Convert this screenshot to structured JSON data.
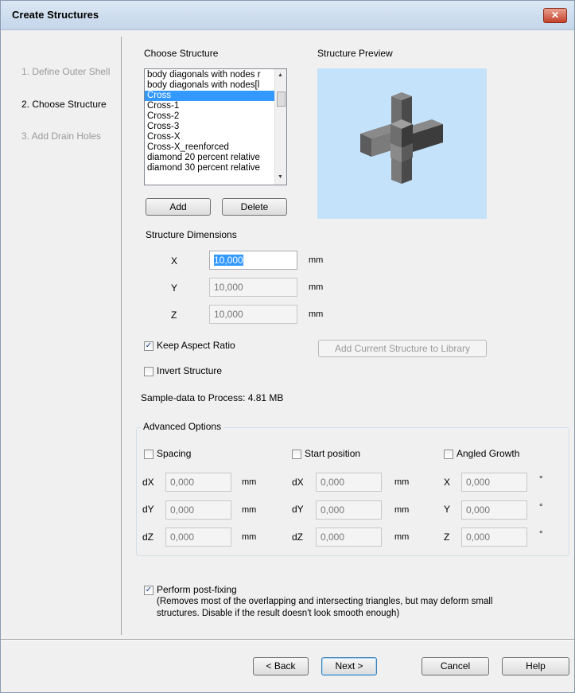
{
  "window": {
    "title": "Create Structures",
    "close_glyph": "✕"
  },
  "nav": {
    "items": [
      {
        "label": "1. Define Outer Shell",
        "state": "disabled"
      },
      {
        "label": "2. Choose Structure",
        "state": "active"
      },
      {
        "label": "3. Add Drain Holes",
        "state": "disabled"
      }
    ]
  },
  "choose": {
    "heading": "Choose Structure",
    "preview_heading": "Structure Preview",
    "list": [
      "body diagonals with nodes r",
      "body diagonals with nodes[l",
      "Cross",
      "Cross-1",
      "Cross-2",
      "Cross-3",
      "Cross-X",
      "Cross-X_reenforced",
      "diamond 20 percent relative",
      "diamond 30 percent relative"
    ],
    "selected": "Cross",
    "add_label": "Add",
    "delete_label": "Delete"
  },
  "dimensions": {
    "heading": "Structure Dimensions",
    "x_label": "X",
    "x_value": "10,000",
    "y_label": "Y",
    "y_value": "10,000",
    "z_label": "Z",
    "z_value": "10,000",
    "unit": "mm"
  },
  "options": {
    "keep_aspect_label": "Keep Aspect Ratio",
    "keep_aspect_checked": true,
    "invert_label": "Invert Structure",
    "invert_checked": false,
    "add_library_label": "Add Current Structure to Library",
    "sample_data": "Sample-data to Process: 4.81 MB"
  },
  "advanced": {
    "title": "Advanced Options",
    "spacing": {
      "label": "Spacing",
      "checked": false,
      "rows": [
        {
          "label": "dX",
          "value": "0,000",
          "unit": "mm"
        },
        {
          "label": "dY",
          "value": "0,000",
          "unit": "mm"
        },
        {
          "label": "dZ",
          "value": "0,000",
          "unit": "mm"
        }
      ]
    },
    "start": {
      "label": "Start position",
      "checked": false,
      "rows": [
        {
          "label": "dX",
          "value": "0,000",
          "unit": "mm"
        },
        {
          "label": "dY",
          "value": "0,000",
          "unit": "mm"
        },
        {
          "label": "dZ",
          "value": "0,000",
          "unit": "mm"
        }
      ]
    },
    "angled": {
      "label": "Angled Growth",
      "checked": false,
      "rows": [
        {
          "label": "X",
          "value": "0,000",
          "unit": "°"
        },
        {
          "label": "Y",
          "value": "0,000",
          "unit": "°"
        },
        {
          "label": "Z",
          "value": "0,000",
          "unit": "°"
        }
      ]
    }
  },
  "postfix": {
    "label": "Perform post-fixing",
    "checked": true,
    "note_line1": "(Removes most of the overlapping and intersecting triangles, but may deform small",
    "note_line2": "structures. Disable if the result doesn't look smooth enough)"
  },
  "footer": {
    "back": "< Back",
    "next": "Next >",
    "cancel": "Cancel",
    "help": "Help"
  },
  "check_glyph": "✓"
}
